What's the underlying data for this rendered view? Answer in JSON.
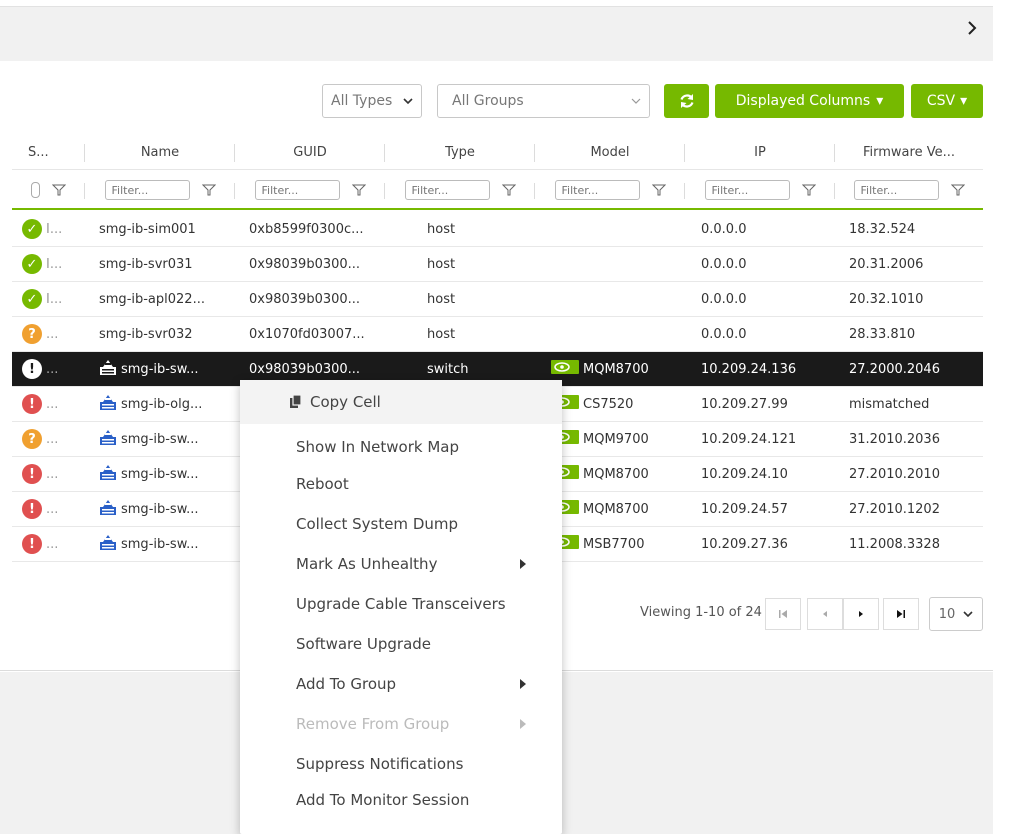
{
  "filters": {
    "types": "All Types",
    "groups": "All Groups"
  },
  "buttons": {
    "refresh_icon": "refresh-icon",
    "displayed_columns": "Displayed Columns",
    "csv": "CSV"
  },
  "columns": [
    "S...",
    "Name",
    "GUID",
    "Type",
    "Model",
    "IP",
    "Firmware Ve..."
  ],
  "filter_placeholder": "Filter...",
  "rows": [
    {
      "status": "ok",
      "status_text": "I...",
      "name": "smg-ib-sim001",
      "guid": "0xb8599f0300c...",
      "type": "host",
      "model": "",
      "ip": "0.0.0.0",
      "firmware": "18.32.524"
    },
    {
      "status": "ok",
      "status_text": "I...",
      "name": "smg-ib-svr031",
      "guid": "0x98039b0300...",
      "type": "host",
      "model": "",
      "ip": "0.0.0.0",
      "firmware": "20.31.2006"
    },
    {
      "status": "ok",
      "status_text": "I...",
      "name": "smg-ib-apl022...",
      "guid": "0x98039b0300...",
      "type": "host",
      "model": "",
      "ip": "0.0.0.0",
      "firmware": "20.32.1010"
    },
    {
      "status": "warn",
      "status_text": "...",
      "name": "smg-ib-svr032",
      "guid": "0x1070fd03007...",
      "type": "host",
      "model": "",
      "ip": "0.0.0.0",
      "firmware": "28.33.810"
    },
    {
      "status": "error",
      "status_text": "...",
      "name": "smg-ib-sw...",
      "guid": "0x98039b0300...",
      "type": "switch",
      "model": "MQM8700",
      "ip": "10.209.24.136",
      "firmware": "27.2000.2046"
    },
    {
      "status": "error",
      "status_text": "...",
      "name": "smg-ib-olg...",
      "guid": "",
      "type": "",
      "model": "CS7520",
      "ip": "10.209.27.99",
      "firmware": "mismatched"
    },
    {
      "status": "warn",
      "status_text": "...",
      "name": "smg-ib-sw...",
      "guid": "",
      "type": "",
      "model": "MQM9700",
      "ip": "10.209.24.121",
      "firmware": "31.2010.2036"
    },
    {
      "status": "error",
      "status_text": "...",
      "name": "smg-ib-sw...",
      "guid": "",
      "type": "",
      "model": "MQM8700",
      "ip": "10.209.24.10",
      "firmware": "27.2010.2010"
    },
    {
      "status": "error",
      "status_text": "...",
      "name": "smg-ib-sw...",
      "guid": "",
      "type": "",
      "model": "MQM8700",
      "ip": "10.209.24.57",
      "firmware": "27.2010.1202"
    },
    {
      "status": "error",
      "status_text": "...",
      "name": "smg-ib-sw...",
      "guid": "",
      "type": "",
      "model": "MSB7700",
      "ip": "10.209.27.36",
      "firmware": "11.2008.3328"
    }
  ],
  "pager": {
    "viewing": "Viewing 1-10 of 24",
    "page_size": "10"
  },
  "context_menu": {
    "copy_cell": "Copy Cell",
    "items": [
      {
        "label": "Show In Network Map",
        "submenu": false,
        "disabled": false
      },
      {
        "label": "Reboot",
        "submenu": false,
        "disabled": false
      },
      {
        "label": "Collect System Dump",
        "submenu": false,
        "disabled": false
      },
      {
        "label": "Mark As Unhealthy",
        "submenu": true,
        "disabled": false
      },
      {
        "label": "Upgrade Cable Transceivers",
        "submenu": false,
        "disabled": false
      },
      {
        "label": "Software Upgrade",
        "submenu": false,
        "disabled": false
      },
      {
        "label": "Add To Group",
        "submenu": true,
        "disabled": false
      },
      {
        "label": "Remove From Group",
        "submenu": true,
        "disabled": true
      },
      {
        "label": "Suppress Notifications",
        "submenu": false,
        "disabled": false
      },
      {
        "label": "Add To Monitor Session",
        "submenu": false,
        "disabled": false
      }
    ]
  },
  "colors": {
    "accent": "#76b900",
    "ok": "#76b900",
    "warn": "#f0a030",
    "error": "#e05050",
    "switch_icon": "#2a60c8",
    "selected_row": "#1a1a1a"
  }
}
